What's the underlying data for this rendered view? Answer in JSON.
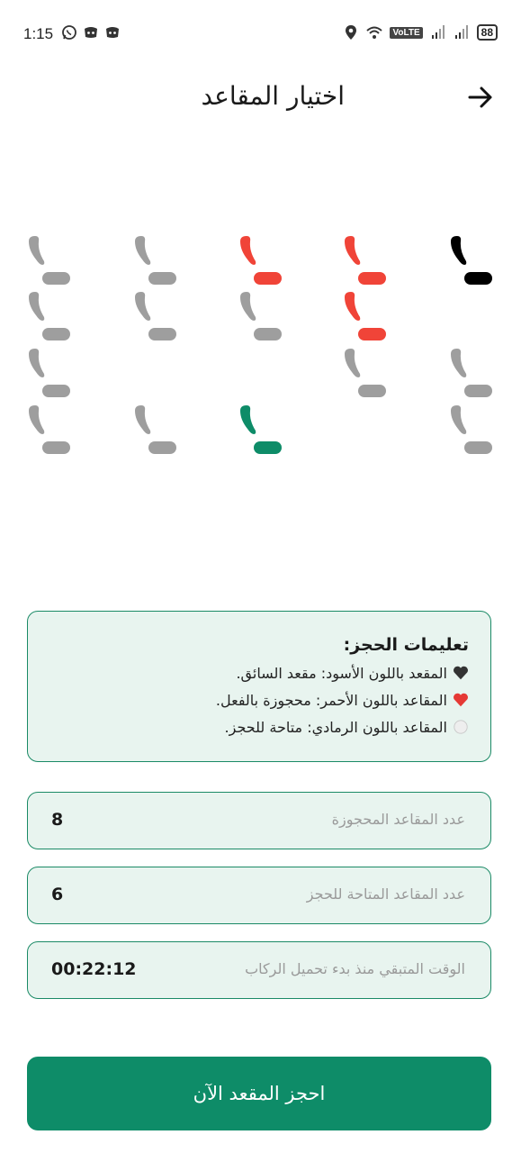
{
  "status_bar": {
    "time": "1:15",
    "volte": "VoLTE",
    "battery": "88"
  },
  "header": {
    "title": "اختيار المقاعد"
  },
  "seat_colors": {
    "driver": "#000000",
    "booked": "#f04438",
    "available": "#9e9e9e",
    "selected": "#0e8c68"
  },
  "seats": [
    {
      "status": "driver"
    },
    {
      "status": "booked"
    },
    {
      "status": "booked"
    },
    {
      "status": "available"
    },
    {
      "status": "available"
    },
    {
      "status": "booked"
    },
    {
      "status": "available"
    },
    {
      "status": "available"
    },
    {
      "status": "available"
    },
    {
      "status": "available"
    },
    {
      "status": "available"
    },
    {
      "status": "available"
    },
    {
      "status": "available"
    },
    {
      "status": "selected"
    },
    {
      "status": "available"
    },
    {
      "status": "available"
    }
  ],
  "instructions": {
    "title": "تعليمات الحجز:",
    "lines": [
      {
        "icon": "black-heart",
        "text": "المقعد باللون الأسود: مقعد السائق."
      },
      {
        "icon": "red-heart",
        "text": "المقاعد باللون الأحمر: محجوزة بالفعل."
      },
      {
        "icon": "white-circle",
        "text": "المقاعد باللون الرمادي: متاحة للحجز."
      }
    ]
  },
  "fields": {
    "booked_count": {
      "label": "عدد المقاعد المحجوزة",
      "value": "8"
    },
    "available_count": {
      "label": "عدد المقاعد المتاحة للحجز",
      "value": "6"
    },
    "time_remaining": {
      "label": "الوقت المتبقي منذ بدء تحميل الركاب",
      "value": "00:22:12"
    }
  },
  "book_button": {
    "label": "احجز المقعد الآن"
  }
}
